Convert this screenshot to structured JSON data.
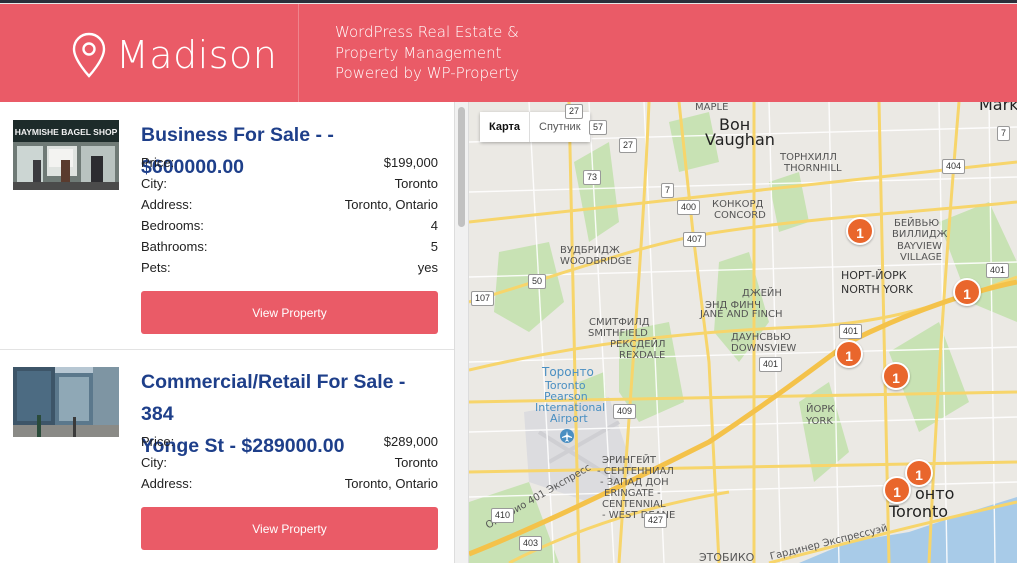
{
  "header": {
    "logo_text": "Madison",
    "tagline": [
      "WordPress Real Estate &",
      "Property Management",
      "Powered by WP-Property"
    ]
  },
  "listings": [
    {
      "title": "Business For Sale - - $600000.00",
      "photo_sign": "HAYMISHE BAGEL SHOP",
      "fields": [
        {
          "label": "Price:",
          "value": "$199,000"
        },
        {
          "label": "City:",
          "value": "Toronto"
        },
        {
          "label": "Address:",
          "value": "Toronto, Ontario"
        },
        {
          "label": "Bedrooms:",
          "value": "4"
        },
        {
          "label": "Bathrooms:",
          "value": "5"
        },
        {
          "label": "Pets:",
          "value": "yes"
        }
      ],
      "button": "View Property"
    },
    {
      "title_lines": [
        "Commercial/Retail For Sale - 384",
        "Yonge St - $289000.00"
      ],
      "fields": [
        {
          "label": "Price:",
          "value": "$289,000"
        },
        {
          "label": "City:",
          "value": "Toronto"
        },
        {
          "label": "Address:",
          "value": "Toronto, Ontario"
        }
      ],
      "button": "View Property"
    }
  ],
  "map": {
    "type_buttons": [
      "Карта",
      "Спутник"
    ],
    "active_type": "Карта",
    "labels": {
      "maple": "MAPLE",
      "von": "Вон",
      "vaughan": "Vaughan",
      "markham": "Markham",
      "thornhill_ru": "ТОРНХИЛЛ",
      "thornhill": "THORNHILL",
      "concord_ru": "КОНКОРД",
      "concord": "CONCORD",
      "woodbridge_ru": "ВУДБРИДЖ",
      "woodbridge": "WOODBRIDGE",
      "bayview_ru1": "БЕЙВЬЮ",
      "bayview_ru2": "ВИЛЛИДЖ",
      "bayview1": "BAYVIEW",
      "bayview2": "VILLAGE",
      "northyork_ru": "НОРТ-ЙОРК",
      "northyork": "NORTH YORK",
      "janefinch_ru": "ДЖЕЙН",
      "janefinch_ru2": "ЭНД ФИНЧ",
      "janefinch": "JANE AND FINCH",
      "smithfield_ru": "СМИТФИЛД",
      "smithfield": "SMITHFIELD",
      "rexdale_ru": "РЕКСДЕЙЛ",
      "rexdale": "REXDALE",
      "downsview_ru": "ДАУНСВЬЮ",
      "downsview": "DOWNSVIEW",
      "pearson1": "Торонто",
      "pearson2": "Toronto",
      "pearson3": "Pearson",
      "pearson4": "International",
      "pearson5": "Airport",
      "york_ru": "ЙОРК",
      "york": "YORK",
      "erin_ru1": "ЭРИНГЕЙТ",
      "erin_ru2": "- СЕНТЕННИАЛ",
      "erin_ru3": "- ЗАПАД ДОН",
      "erin1": "ERINGATE -",
      "erin2": "CENTENNIAL",
      "erin3": "- WEST DEANE",
      "toronto_ru": "онто",
      "toronto": "Toronto",
      "etobicoke": "ЭТОБИКО",
      "hwy401_ru": "Онтарио 401 Экспресс",
      "gardiner_ru": "Гардинер Экспрессуэй"
    },
    "shields": [
      "57",
      "27",
      "73",
      "400",
      "7",
      "407",
      "7",
      "404",
      "401",
      "50",
      "107",
      "401",
      "401",
      "409",
      "410",
      "427",
      "403",
      "27"
    ],
    "markers": [
      "1",
      "1",
      "1",
      "1",
      "1",
      "1",
      "1"
    ]
  },
  "colors": {
    "brand": "#ea5b67",
    "title": "#1e3f8a",
    "marker": "#e9662c"
  }
}
